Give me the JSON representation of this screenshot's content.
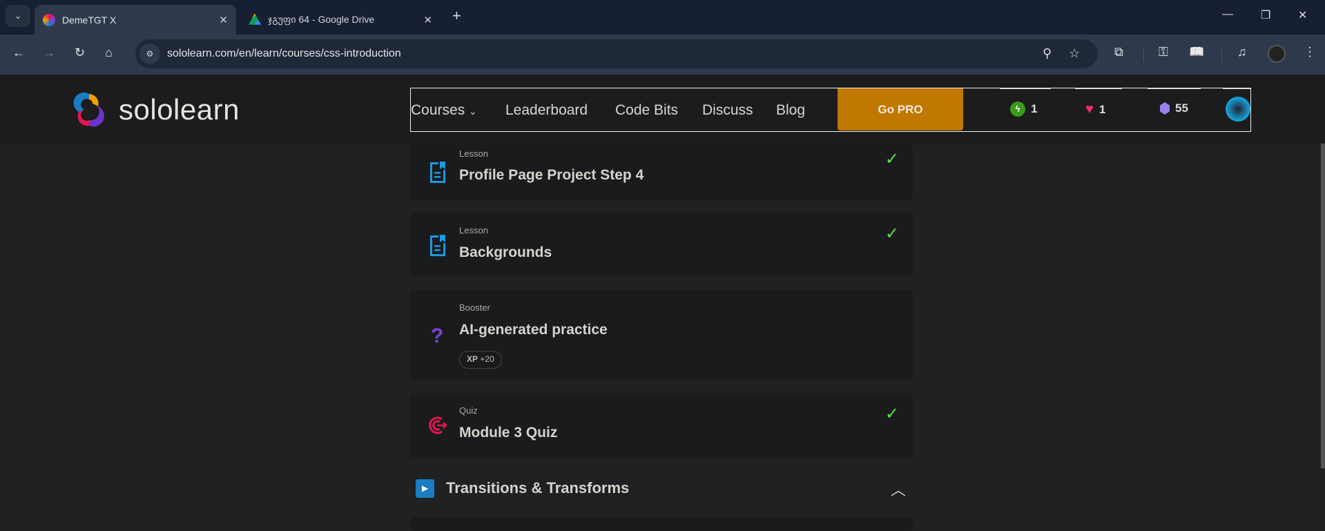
{
  "browser": {
    "tabs": [
      {
        "title": "DemeTGT X",
        "active": true
      },
      {
        "title": "ჯგუფი 64 - Google Drive",
        "active": false
      }
    ],
    "url": "sololearn.com/en/learn/courses/css-introduction"
  },
  "site": {
    "logo_text": "sololearn",
    "nav": [
      "Courses",
      "Leaderboard",
      "Code Bits",
      "Discuss",
      "Blog"
    ],
    "go_pro": "Go PRO",
    "stats": {
      "streak": "1",
      "hearts": "1",
      "gems": "55"
    }
  },
  "items": [
    {
      "type": "Lesson",
      "title": "Profile Page Project Step 4",
      "completed": true,
      "icon": "lesson-icon"
    },
    {
      "type": "Lesson",
      "title": "Backgrounds",
      "completed": true,
      "icon": "lesson-icon"
    },
    {
      "type": "Booster",
      "title": "AI-generated practice",
      "completed": false,
      "icon": "question-icon",
      "xp_label": "XP",
      "xp_value": "+20"
    },
    {
      "type": "Quiz",
      "title": "Module 3 Quiz",
      "completed": true,
      "icon": "target-icon"
    }
  ],
  "section": {
    "title": "Transitions & Transforms"
  },
  "colors": {
    "accent": "#c07800",
    "check": "#5fe04a",
    "lesson": "#1a9be0",
    "quiz": "#e8154f",
    "booster": "#7a45d8"
  }
}
